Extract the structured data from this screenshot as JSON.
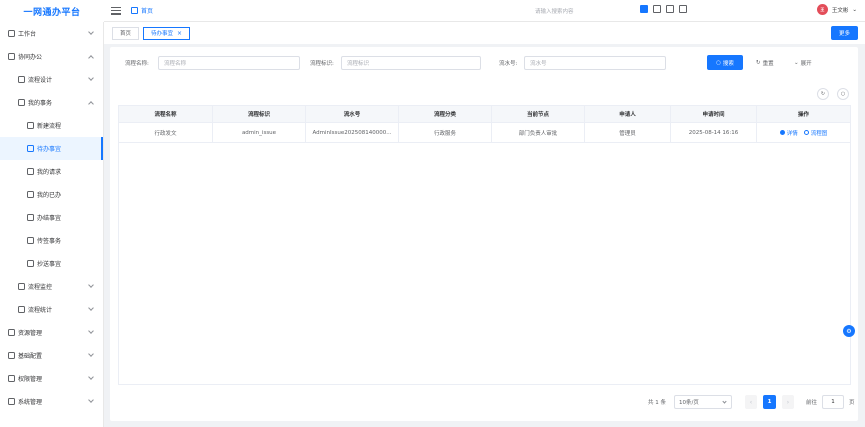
{
  "app": {
    "title": "一网通办平台"
  },
  "header": {
    "breadcrumb": "首页",
    "search_placeholder": "请输入搜索内容",
    "user_name": "王文彬",
    "avatar_text": "王"
  },
  "tabs": [
    {
      "label": "首页"
    },
    {
      "label": "待办事宜",
      "close": "×"
    }
  ],
  "more_label": "更多",
  "sidebar": {
    "items": [
      {
        "label": "工作台"
      },
      {
        "label": "协同办公"
      },
      {
        "label": "流程设计"
      },
      {
        "label": "我的事务"
      },
      {
        "label": "新建流程"
      },
      {
        "label": "待办事宜"
      },
      {
        "label": "我的请求"
      },
      {
        "label": "我的已办"
      },
      {
        "label": "办结事宜"
      },
      {
        "label": "传签事务"
      },
      {
        "label": "抄送事宜"
      },
      {
        "label": "流程监控"
      },
      {
        "label": "流程统计"
      },
      {
        "label": "资源管理"
      },
      {
        "label": "基础配置"
      },
      {
        "label": "权限管理"
      },
      {
        "label": "系统管理"
      }
    ]
  },
  "filters": {
    "name_label": "流程名称:",
    "name_placeholder": "流程名称",
    "key_label": "流程标识:",
    "key_placeholder": "流程标识",
    "serial_label": "流水号:",
    "serial_placeholder": "流水号",
    "search_label": "搜索",
    "reset_label": "重置",
    "expand_label": "展开"
  },
  "table": {
    "columns": [
      "流程名称",
      "流程标识",
      "流水号",
      "流程分类",
      "当前节点",
      "申请人",
      "申请时间",
      "操作"
    ],
    "rows": [
      {
        "name": "行政发文",
        "key": "admin_issue",
        "serial": "AdminIssue202508140000...",
        "category": "行政服务",
        "node": "部门负责人审批",
        "applicant": "管理员",
        "time": "2025-08-14 16:16",
        "action_detail": "详情",
        "action_flow": "流程图"
      }
    ]
  },
  "pager": {
    "total": "共 1 条",
    "size": "10条/页",
    "prev": "‹",
    "current": "1",
    "next": "›",
    "goto_label": "前往",
    "goto_value": "1",
    "page_unit": "页"
  }
}
